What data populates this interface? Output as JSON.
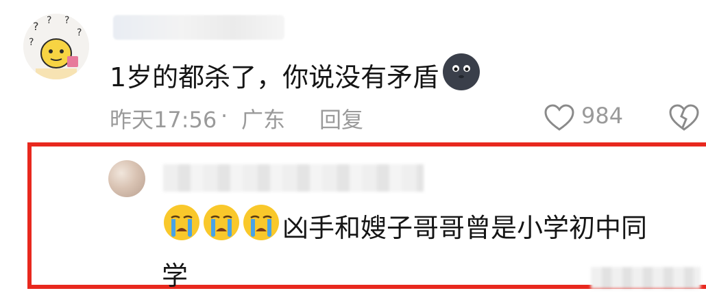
{
  "comment": {
    "text": "1岁的都杀了，你说没有矛盾",
    "time": "昨天17:56",
    "separator": "·",
    "location": "广东",
    "reply_label": "回复",
    "like_count": "984"
  },
  "reply": {
    "text_line1": "凶手和嫂子哥哥曾是小学初中同",
    "text_line2": "学"
  },
  "colors": {
    "highlight_border": "#e8281e",
    "meta_text": "#9a9a9a",
    "body_text": "#151515"
  }
}
